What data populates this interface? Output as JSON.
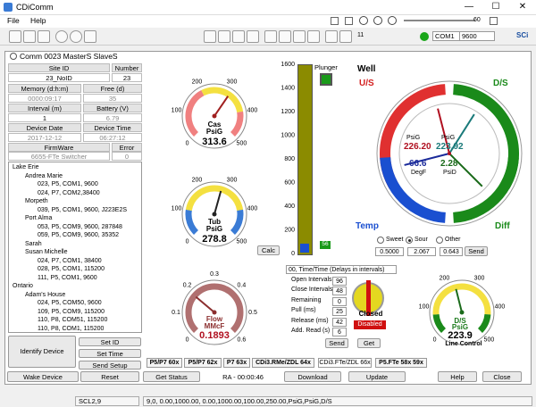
{
  "app": {
    "title": "CDiComm",
    "window_controls": {
      "min": "—",
      "max": "☐",
      "close": "✕"
    }
  },
  "menu": {
    "file": "File",
    "help": "Help"
  },
  "toolbar": {
    "connection_led": "#1aa61a",
    "com_port": "COM1",
    "baud": "9600",
    "slider1_value": "60",
    "slider2_value": "11",
    "brand": "SCi"
  },
  "panel": {
    "title": "Comm 0023 MasterS SlaveS"
  },
  "info_grid": {
    "site_id_label": "Site ID",
    "number_label": "Number",
    "site_id": "23_NoID",
    "number": "23",
    "memory_label": "Memory (d:h:m)",
    "free_label": "Free (d)",
    "memory": "0000:09:17",
    "free": "35",
    "interval_label": "Interval (m)",
    "battery_label": "Battery (V)",
    "interval": "1",
    "battery": "6.79",
    "device_date_label": "Device Date",
    "device_time_label": "Device Time",
    "device_date": "2017-12-12",
    "device_time": "06:27:12",
    "firmware_label": "FirmWare",
    "error_label": "Error",
    "firmware": "6655-FTe Switcher",
    "error": "0"
  },
  "tree": [
    {
      "text": "Lake Erie",
      "level": 0
    },
    {
      "text": "Andrea Marie",
      "level": 1
    },
    {
      "text": "023, P5, COM1, 9600",
      "level": 2
    },
    {
      "text": "024, P7, COM2,38400",
      "level": 2
    },
    {
      "text": "Morpeth",
      "level": 1
    },
    {
      "text": "039, P5, COM1, 9600, J223E2S",
      "level": 2
    },
    {
      "text": "Port Alma",
      "level": 1
    },
    {
      "text": "053, P5, COM9, 9600, 287848",
      "level": 2
    },
    {
      "text": "059, P5, COM9, 9600, 35352",
      "level": 2
    },
    {
      "text": "Sarah",
      "level": 1
    },
    {
      "text": "Susan Michelle",
      "level": 1
    },
    {
      "text": "024, P7, COM1, 38400",
      "level": 2
    },
    {
      "text": "028, P5, COM1, 115200",
      "level": 2
    },
    {
      "text": "111, P5, COM1, 9600",
      "level": 2
    },
    {
      "text": "Ontario",
      "level": 0
    },
    {
      "text": "Adam's House",
      "level": 1
    },
    {
      "text": "024, P5, COM50, 9600",
      "level": 2
    },
    {
      "text": "109, P5, COM9, 115200",
      "level": 2
    },
    {
      "text": "110, P8, COM51, 115200",
      "level": 2
    },
    {
      "text": "110, P8, COM1, 115200",
      "level": 2
    }
  ],
  "buttons": {
    "identify": "Identify Device",
    "set_id": "Set ID",
    "set_time": "Set Time",
    "send_setup": "Send Setup",
    "calc": "Calc",
    "send": "Send",
    "get": "Get",
    "send2": "Send"
  },
  "gauges": {
    "cas": {
      "name": "Cas",
      "unit": "PsiG",
      "value": "313.6",
      "ticks": [
        "0",
        "100",
        "200",
        "300",
        "400",
        "500"
      ]
    },
    "tub": {
      "name": "Tub",
      "unit": "PsiG",
      "value": "278.8",
      "ticks": [
        "0",
        "100",
        "200",
        "300",
        "400",
        "500"
      ]
    },
    "flow": {
      "name": "Flow",
      "unit": "MMcF",
      "value": "0.1893",
      "ticks": [
        "0",
        "0.1",
        "0.2",
        "0.3",
        "0.4",
        "0.5",
        "0.6"
      ]
    },
    "line": {
      "name": "D/S",
      "unit": "PsiG",
      "value": "223.9",
      "caption": "Line Control",
      "ticks": [
        "0",
        "100",
        "200",
        "300",
        "400",
        "500"
      ]
    }
  },
  "plunger": {
    "label": "Plunger",
    "level": 56,
    "ticks": [
      "1600",
      "1400",
      "1200",
      "1000",
      "800",
      "600",
      "400",
      "200",
      "0"
    ]
  },
  "well": {
    "title": "Well",
    "us": "U/S",
    "ds": "D/S",
    "temp": "Temp",
    "diff": "Diff",
    "center": {
      "psig_label1": "PsiG",
      "psig1": "226.20",
      "psig_label2": "PsiG",
      "psig2": "223.92",
      "degf": "66.6",
      "degf_label": "DegF",
      "psid": "2.28",
      "psid_label": "PsiD"
    },
    "radio": {
      "sweet": "Sweet",
      "sour": "Sour",
      "other": "Other",
      "selected": "Sour"
    },
    "inputs": {
      "a": "0.5000",
      "b": "2.067",
      "c": "0.643"
    }
  },
  "control": {
    "mode": "00, Time/Time (Delays in intervals)",
    "rows": [
      {
        "label": "Open Intervals",
        "value": "96"
      },
      {
        "label": "Close Intervals",
        "value": "48"
      },
      {
        "label": "Remaining",
        "value": "0"
      },
      {
        "label": "Pull (ms)",
        "value": "25"
      },
      {
        "label": "Release (ms)",
        "value": "42"
      },
      {
        "label": "Add. Read (s)",
        "value": "6"
      }
    ],
    "valve_state": "Closed",
    "status": "Disabled"
  },
  "tabs": [
    "P5/P7 60x",
    "P5/P7 62x",
    "P7 63x",
    "CDi3.RMe/ZDL 64x",
    "CDi3.FTe/ZDL 66x",
    "P5.FTe 58x 59x"
  ],
  "bottom": {
    "wake": "Wake Device",
    "reset": "Reset",
    "get_status": "Get Status",
    "ra": "RA - 00:00:46",
    "download": "Download",
    "update": "Update",
    "help": "Help",
    "close": "Close"
  },
  "status": {
    "left": "SCL2,9",
    "right": "9,0, 0.00,1000.00, 0.00,1000.00,100.00,250.00,PsiG,PsiG,D/S"
  }
}
